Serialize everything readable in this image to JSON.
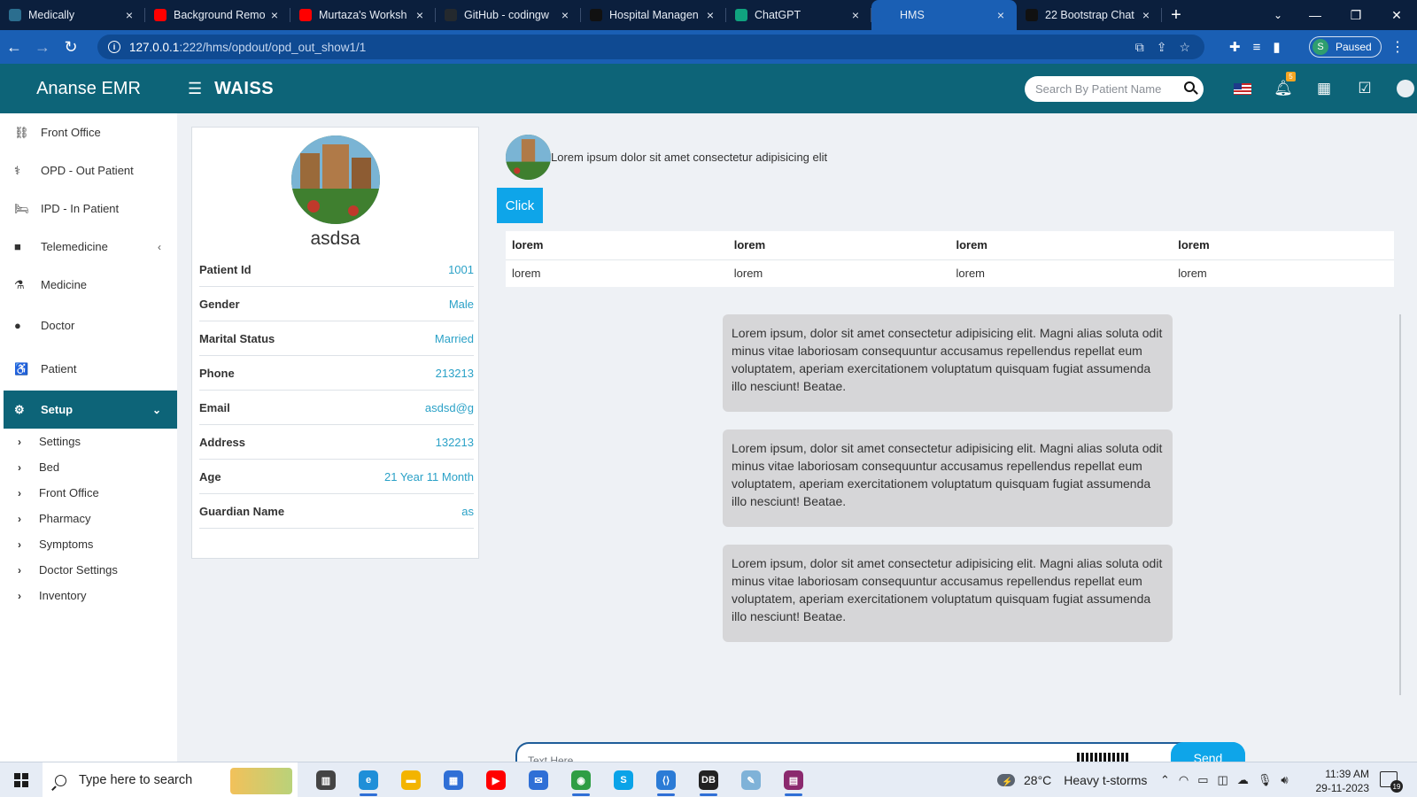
{
  "browser": {
    "tabs": [
      {
        "title": "Medically",
        "favicon": "medically-icon",
        "color": "#2b6e8f"
      },
      {
        "title": "Background Remo",
        "favicon": "youtube-icon",
        "color": "#ff0000"
      },
      {
        "title": "Murtaza's Worksh",
        "favicon": "youtube-icon",
        "color": "#ff0000"
      },
      {
        "title": "GitHub - codingw",
        "favicon": "github-icon",
        "color": "#24292e"
      },
      {
        "title": "Hospital Managen",
        "favicon": "hospital-icon",
        "color": "#111111"
      },
      {
        "title": "ChatGPT",
        "favicon": "chatgpt-icon",
        "color": "#10a37f"
      },
      {
        "title": "HMS",
        "favicon": "hms-icon",
        "color": "#1a5fb4"
      },
      {
        "title": "22 Bootstrap Chat",
        "favicon": "bootstrap-icon",
        "color": "#111111"
      }
    ],
    "active_tab": 6,
    "url_host": "127.0.0.1",
    "url_path": ":222/hms/opdout/opd_out_show1/1",
    "profile_initial": "S",
    "profile_status": "Paused"
  },
  "app": {
    "brand": "Ananse EMR",
    "title": "WAISS",
    "search_placeholder": "Search By Patient Name",
    "notification_count": "5"
  },
  "sidebar": {
    "items": [
      {
        "label": "Front Office",
        "icon": "front-office-icon",
        "glyph": "⛓"
      },
      {
        "label": "OPD - Out Patient",
        "icon": "stethoscope-icon",
        "glyph": "⚕"
      },
      {
        "label": "IPD - In Patient",
        "icon": "bed-icon",
        "glyph": "🛏"
      },
      {
        "label": "Telemedicine",
        "icon": "video-icon",
        "glyph": "■"
      },
      {
        "label": "Medicine",
        "icon": "mortar-icon",
        "glyph": "⚗"
      },
      {
        "label": "Doctor",
        "icon": "doctor-icon",
        "glyph": "●"
      },
      {
        "label": "Patient",
        "icon": "patient-icon",
        "glyph": "♿"
      },
      {
        "label": "Setup",
        "icon": "gears-icon",
        "glyph": "⚙"
      }
    ],
    "setup_children": [
      "Settings",
      "Bed",
      "Front Office",
      "Pharmacy",
      "Symptoms",
      "Doctor Settings",
      "Inventory"
    ]
  },
  "patient": {
    "name": "asdsa",
    "fields": [
      {
        "key": "Patient Id",
        "value": "1001"
      },
      {
        "key": "Gender",
        "value": "Male"
      },
      {
        "key": "Marital Status",
        "value": "Married"
      },
      {
        "key": "Phone",
        "value": "213213"
      },
      {
        "key": "Email",
        "value": "asdsd@g"
      },
      {
        "key": "Address",
        "value": "132213"
      },
      {
        "key": "Age",
        "value": "21 Year 11 Month"
      },
      {
        "key": "Guardian Name",
        "value": "as"
      }
    ]
  },
  "chat": {
    "header_text": "Lorem ipsum dolor sit amet consectetur adipisicing elit",
    "click_label": "Click",
    "table": {
      "headers": [
        "lorem",
        "lorem",
        "lorem",
        "lorem"
      ],
      "rows": [
        [
          "lorem",
          "lorem",
          "lorem",
          "lorem"
        ]
      ]
    },
    "messages": [
      "Lorem ipsum, dolor sit amet consectetur adipisicing elit. Magni alias soluta odit minus vitae laboriosam consequuntur accusamus repellendus repellat eum voluptatem, aperiam exercitationem voluptatum quisquam fugiat assumenda illo nesciunt! Beatae.",
      "Lorem ipsum, dolor sit amet consectetur adipisicing elit. Magni alias soluta odit minus vitae laboriosam consequuntur accusamus repellendus repellat eum voluptatem, aperiam exercitationem voluptatum quisquam fugiat assumenda illo nesciunt! Beatae.",
      "Lorem ipsum, dolor sit amet consectetur adipisicing elit. Magni alias soluta odit minus vitae laboriosam consequuntur accusamus repellendus repellat eum voluptatem, aperiam exercitationem voluptatum quisquam fugiat assumenda illo nesciunt! Beatae."
    ],
    "input_placeholder": "Text Here",
    "send_label": "Send"
  },
  "taskbar": {
    "search_placeholder": "Type here to search",
    "apps": [
      {
        "name": "task-view-icon",
        "color": "#444444",
        "glyph": "▥"
      },
      {
        "name": "edge-icon",
        "color": "#1f8fd8",
        "glyph": "e"
      },
      {
        "name": "file-explorer-icon",
        "color": "#f3b400",
        "glyph": "▬"
      },
      {
        "name": "store-icon",
        "color": "#2f6fd6",
        "glyph": "▦"
      },
      {
        "name": "youtube-icon",
        "color": "#ff0000",
        "glyph": "▶"
      },
      {
        "name": "mail-icon",
        "color": "#2f6fd6",
        "glyph": "✉"
      },
      {
        "name": "chrome-icon",
        "color": "#2f9e44",
        "glyph": "◉"
      },
      {
        "name": "skype-icon",
        "color": "#0aa3e8",
        "glyph": "S"
      },
      {
        "name": "vscode-icon",
        "color": "#2b7bd6",
        "glyph": "⟨⟩"
      },
      {
        "name": "mysql-icon",
        "color": "#222222",
        "glyph": "DB"
      },
      {
        "name": "notepad-icon",
        "color": "#7fb2d8",
        "glyph": "✎"
      },
      {
        "name": "winrar-icon",
        "color": "#8b2a6e",
        "glyph": "▤"
      }
    ],
    "weather": "28°C",
    "weather_desc": "Heavy t-storms",
    "time": "11:39 AM",
    "date": "29-11-2023",
    "notif_count": "19"
  },
  "colors": {
    "header": "#0d6478",
    "accent": "#0ea5e9",
    "value_text": "#2aa1c7"
  }
}
